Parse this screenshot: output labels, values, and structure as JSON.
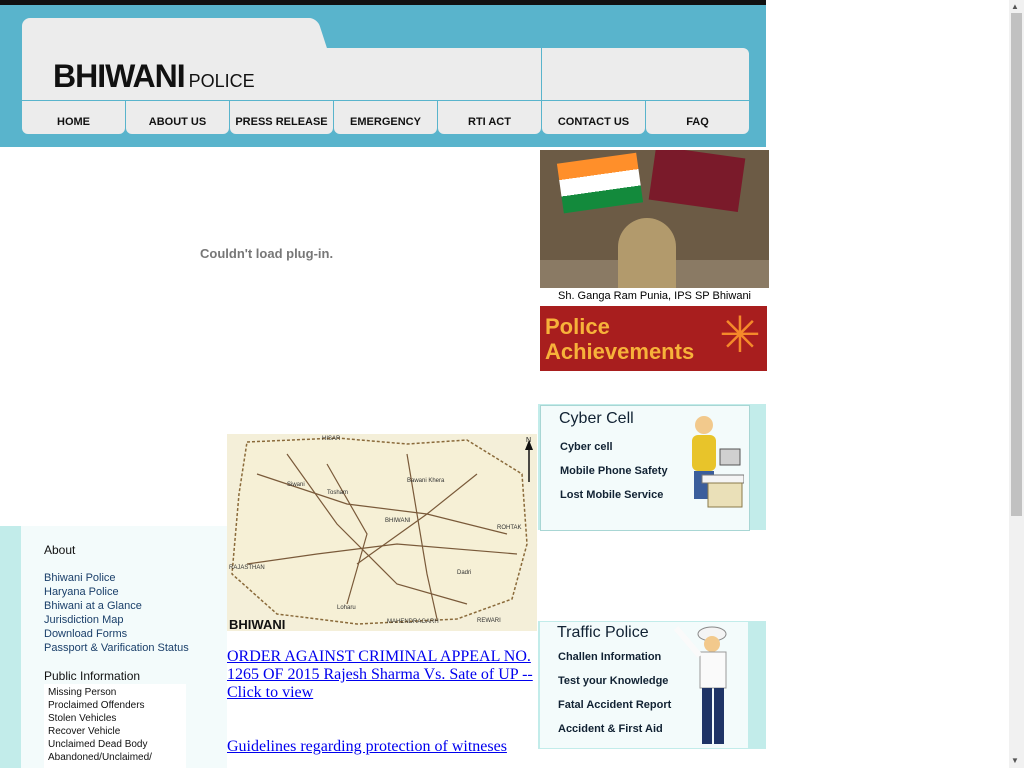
{
  "logo": {
    "big": "BHIWANI",
    "small": "POLICE"
  },
  "nav": [
    "HOME",
    "ABOUT US",
    "PRESS RELEASE",
    "EMERGENCY",
    "RTI ACT",
    "CONTACT US",
    "FAQ"
  ],
  "plugin_message": "Couldn't load plug-in.",
  "sp": {
    "caption": "Sh. Ganga Ram Punia, IPS SP Bhiwani"
  },
  "achievements": {
    "line1": "Police",
    "line2": "Achievements"
  },
  "cyber_cell": {
    "title": "Cyber Cell",
    "links": [
      "Cyber cell",
      "Mobile Phone Safety",
      "Lost Mobile Service"
    ]
  },
  "traffic_police": {
    "title": "Traffic Police",
    "links": [
      "Challen Information",
      "Test your Knowledge",
      "Fatal Accident Report",
      "Accident & First Aid"
    ]
  },
  "map": {
    "label": "BHIWANI",
    "place_names": [
      "HISAR",
      "ROHTAK",
      "RAJASTHAN",
      "REWARI",
      "MAHENDRAGARH",
      "BHIWANI",
      "Dadri",
      "Loharu",
      "Tosham",
      "Bawani Khera",
      "Siwani"
    ],
    "north": "N"
  },
  "main_links": [
    "ORDER AGAINST CRIMINAL APPEAL NO. 1265 OF 2015 Rajesh Sharma Vs. Sate of UP -- Click to view ",
    "Guidelines regarding protection of witneses"
  ],
  "sidebar": {
    "about_heading": "About",
    "about_links": [
      "Bhiwani Police",
      "Haryana Police",
      "Bhiwani at a Glance",
      "Jurisdiction  Map",
      "Download Forms",
      "Passport & Varification Status"
    ],
    "public_heading": "Public Information",
    "public_links": [
      "Missing Person",
      "Proclaimed Offenders",
      "Stolen Vehicles",
      "Recover Vehicle",
      "Unclaimed  Dead Body",
      "Abandoned/Unclaimed/"
    ]
  },
  "colors": {
    "header": "#59b4cc",
    "panel": "#ececec",
    "box_bg": "#c2ecea",
    "achievement_bg": "#a81e1e",
    "link": "#0000ee"
  }
}
